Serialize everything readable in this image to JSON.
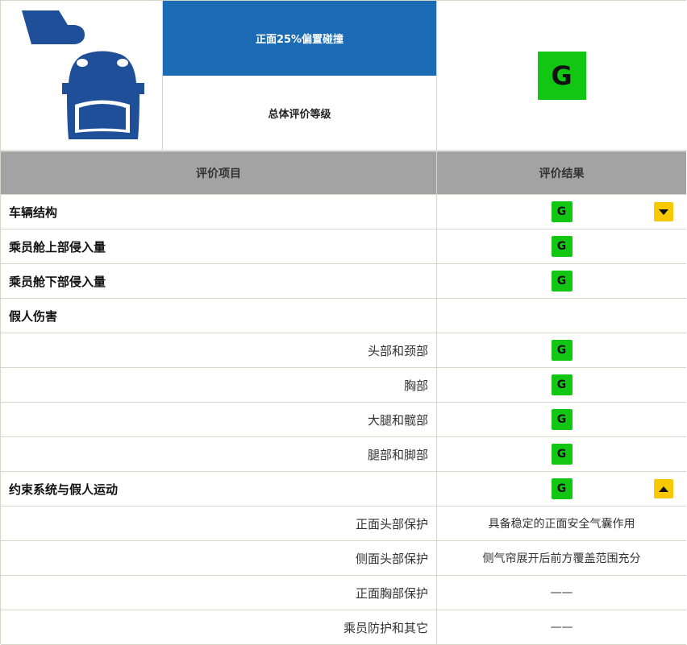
{
  "header": {
    "test_title": "正面25%偏置碰撞",
    "overall_label": "总体评价等级",
    "overall_rating": "G"
  },
  "columns": {
    "item": "评价项目",
    "result": "评价结果"
  },
  "rows": [
    {
      "label": "车辆结构",
      "level": "main",
      "result": "G",
      "arrow": "down"
    },
    {
      "label": "乘员舱上部侵入量",
      "level": "main",
      "result": "G"
    },
    {
      "label": "乘员舱下部侵入量",
      "level": "main",
      "result": "G"
    },
    {
      "label": "假人伤害",
      "level": "main",
      "result": ""
    },
    {
      "label": "头部和颈部",
      "level": "sub",
      "result": "G"
    },
    {
      "label": "胸部",
      "level": "sub",
      "result": "G"
    },
    {
      "label": "大腿和髋部",
      "level": "sub",
      "result": "G"
    },
    {
      "label": "腿部和脚部",
      "level": "sub",
      "result": "G"
    },
    {
      "label": "约束系统与假人运动",
      "level": "main",
      "result": "G",
      "arrow": "up"
    },
    {
      "label": "正面头部保护",
      "level": "sub",
      "text": "具备稳定的正面安全气囊作用"
    },
    {
      "label": "侧面头部保护",
      "level": "sub",
      "text": "侧气帘展开后前方覆盖范围充分"
    },
    {
      "label": "正面胸部保护",
      "level": "sub",
      "text": "——"
    },
    {
      "label": "乘员防护和其它",
      "level": "sub",
      "text": "——"
    }
  ],
  "colors": {
    "title_bg": "#1b6bb5",
    "rating_good": "#12c714",
    "arrow_bg": "#f8c800",
    "header_gray": "#a3a3a3",
    "logo_blue": "#1e4f98"
  },
  "icons": {
    "logo": "car-front-offset-crash-icon",
    "arrow_down": "triangle-down-icon",
    "arrow_up": "triangle-up-icon"
  }
}
